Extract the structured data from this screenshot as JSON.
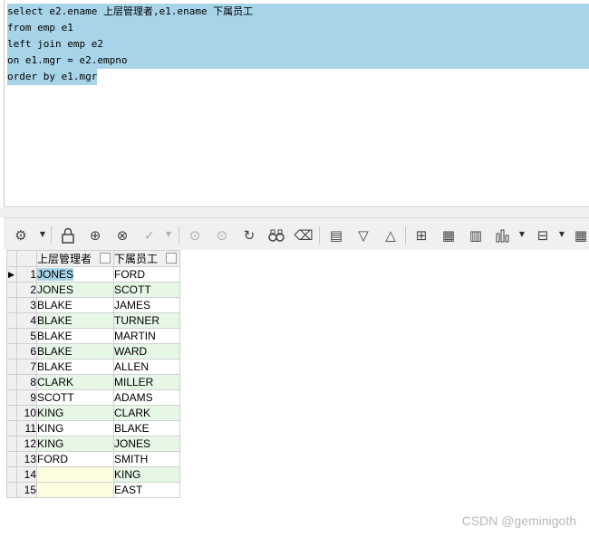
{
  "editor": {
    "lines": [
      "select e2.ename 上层管理者,e1.ename 下属员工",
      "from emp e1",
      "left join emp e2",
      "on e1.mgr = e2.empno",
      "order by e1.mgr"
    ],
    "selection_color": "#a8d4ea"
  },
  "toolbar": {
    "icons": [
      "grid-options-icon",
      "lock-icon",
      "add-row-icon",
      "delete-row-icon",
      "post-icon",
      "move-down-icon",
      "fetch-next-icon",
      "refresh-icon",
      "find-icon",
      "clear-icon",
      "table-view-icon",
      "filter-desc-icon",
      "filter-asc-icon",
      "tree-icon",
      "export-icon",
      "statistics-icon",
      "chart-icon",
      "group-icon",
      "record-view-icon"
    ]
  },
  "grid": {
    "headers": [
      "上层管理者",
      "下属员工"
    ],
    "rows": [
      {
        "num": "1",
        "mgr": "JONES",
        "emp": "FORD"
      },
      {
        "num": "2",
        "mgr": "JONES",
        "emp": "SCOTT"
      },
      {
        "num": "3",
        "mgr": "BLAKE",
        "emp": "JAMES"
      },
      {
        "num": "4",
        "mgr": "BLAKE",
        "emp": "TURNER"
      },
      {
        "num": "5",
        "mgr": "BLAKE",
        "emp": "MARTIN"
      },
      {
        "num": "6",
        "mgr": "BLAKE",
        "emp": "WARD"
      },
      {
        "num": "7",
        "mgr": "BLAKE",
        "emp": "ALLEN"
      },
      {
        "num": "8",
        "mgr": "CLARK",
        "emp": "MILLER"
      },
      {
        "num": "9",
        "mgr": "SCOTT",
        "emp": "ADAMS"
      },
      {
        "num": "10",
        "mgr": "KING",
        "emp": "CLARK"
      },
      {
        "num": "11",
        "mgr": "KING",
        "emp": "BLAKE"
      },
      {
        "num": "12",
        "mgr": "KING",
        "emp": "JONES"
      },
      {
        "num": "13",
        "mgr": "FORD",
        "emp": "SMITH"
      },
      {
        "num": "14",
        "mgr": "",
        "emp": "KING"
      },
      {
        "num": "15",
        "mgr": "",
        "emp": "EAST"
      }
    ],
    "current_row": 1,
    "alt_row_color": "#e6f7e6",
    "null_cell_color": "#fdfde0"
  },
  "watermark": "CSDN @geminigoth"
}
